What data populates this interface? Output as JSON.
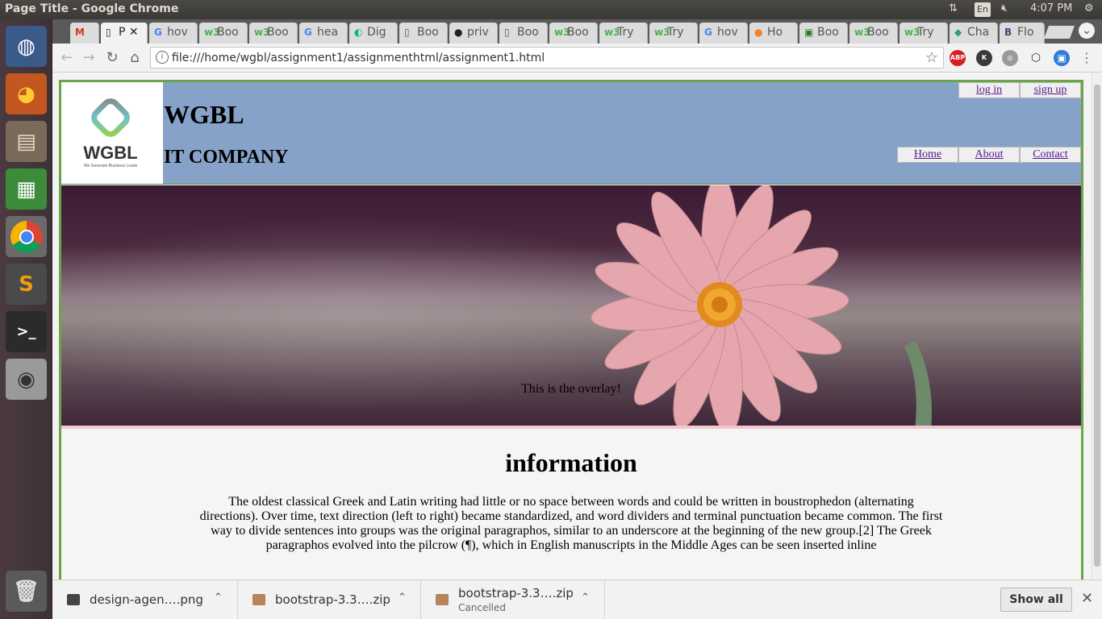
{
  "os": {
    "window_title": "Page Title - Google Chrome",
    "clock": "4:07 PM",
    "keyboard": "En"
  },
  "tabs": [
    {
      "icon": "M",
      "label": ""
    },
    {
      "icon": "▯",
      "label": "P"
    },
    {
      "icon": "G",
      "label": "hov"
    },
    {
      "icon": "w3",
      "label": "Boo"
    },
    {
      "icon": "w3",
      "label": "Boo"
    },
    {
      "icon": "G",
      "label": "hea"
    },
    {
      "icon": "◐",
      "label": "Dig"
    },
    {
      "icon": "▯",
      "label": "Boo"
    },
    {
      "icon": "●",
      "label": "priv"
    },
    {
      "icon": "▯",
      "label": "Boo"
    },
    {
      "icon": "w3",
      "label": "Boo"
    },
    {
      "icon": "w3",
      "label": "Try"
    },
    {
      "icon": "w3",
      "label": "Try"
    },
    {
      "icon": "G",
      "label": "hov"
    },
    {
      "icon": "●",
      "label": "Ho"
    },
    {
      "icon": "▣",
      "label": "Boo"
    },
    {
      "icon": "w3",
      "label": "Boo"
    },
    {
      "icon": "w3",
      "label": "Try"
    },
    {
      "icon": "◆",
      "label": "Cha"
    },
    {
      "icon": "B",
      "label": "Flo"
    }
  ],
  "address_bar": {
    "url": "file:///home/wgbl/assignment1/assignmenthtml/assignment1.html"
  },
  "extensions": [
    {
      "name": "adblock-plus-icon",
      "text": "ABP",
      "color": "#d81e24"
    },
    {
      "name": "extension-k-icon",
      "text": "K",
      "color": "#3a3a3a"
    },
    {
      "name": "extension-grey-icon",
      "text": "◎",
      "color": "#9a9a9a"
    },
    {
      "name": "extension-cube-icon",
      "text": "⬡",
      "color": "#555555"
    },
    {
      "name": "extension-blue-icon",
      "text": "▣",
      "color": "#2f7bd6"
    }
  ],
  "site": {
    "brand": "WGBL",
    "tagline": "We Generate Business Leads",
    "title": "WGBL",
    "subtitle": "IT COMPANY",
    "auth_links": [
      "log in",
      "sign up"
    ],
    "nav_links": [
      "Home",
      "About",
      "Contact"
    ],
    "overlay_text": "This is the overlay!",
    "info_title": "information",
    "info_paragraph": "The oldest classical Greek and Latin writing had little or no space between words and could be written in boustrophedon (alternating directions). Over time, text direction (left to right) became standardized, and word dividers and terminal punctuation became common. The first way to divide sentences into groups was the original paragraphos, similar to an underscore at the beginning of the new group.[2] The Greek paragraphos evolved into the pilcrow (¶), which in English manuscripts in the Middle Ages can be seen inserted inline"
  },
  "downloads": [
    {
      "name": "design-agen….png",
      "status": ""
    },
    {
      "name": "bootstrap-3.3….zip",
      "status": ""
    },
    {
      "name": "bootstrap-3.3….zip",
      "status": "Cancelled"
    }
  ],
  "downloads_show_all": "Show all",
  "colors": {
    "header_bg": "#87a2c8",
    "page_border": "#6ba54a",
    "link": "#551a8b"
  }
}
